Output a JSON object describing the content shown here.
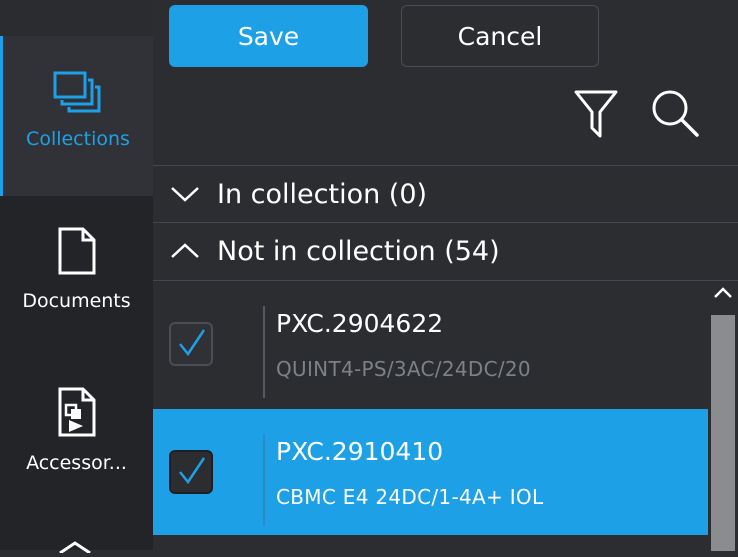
{
  "sidebar": {
    "items": [
      {
        "label": "Collections",
        "icon": "collections-icon",
        "active": true
      },
      {
        "label": "Documents",
        "icon": "document-icon",
        "active": false
      },
      {
        "label": "Accessor...",
        "icon": "accessories-icon",
        "active": false
      }
    ]
  },
  "toolbar": {
    "save_label": "Save",
    "cancel_label": "Cancel"
  },
  "groups": {
    "in_collection": "In collection (0)",
    "not_in_collection": "Not in collection (54)"
  },
  "list": {
    "rows": [
      {
        "title": "PXC.2904622",
        "subtitle": "QUINT4-PS/3AC/24DC/20",
        "checked": true,
        "selected": false
      },
      {
        "title": "PXC.2910410",
        "subtitle": "CBMC E4 24DC/1-4A+ IOL",
        "checked": true,
        "selected": true
      }
    ]
  },
  "colors": {
    "accent": "#1ea0e6",
    "background": "#2b2d31",
    "sidebar": "#222427"
  }
}
